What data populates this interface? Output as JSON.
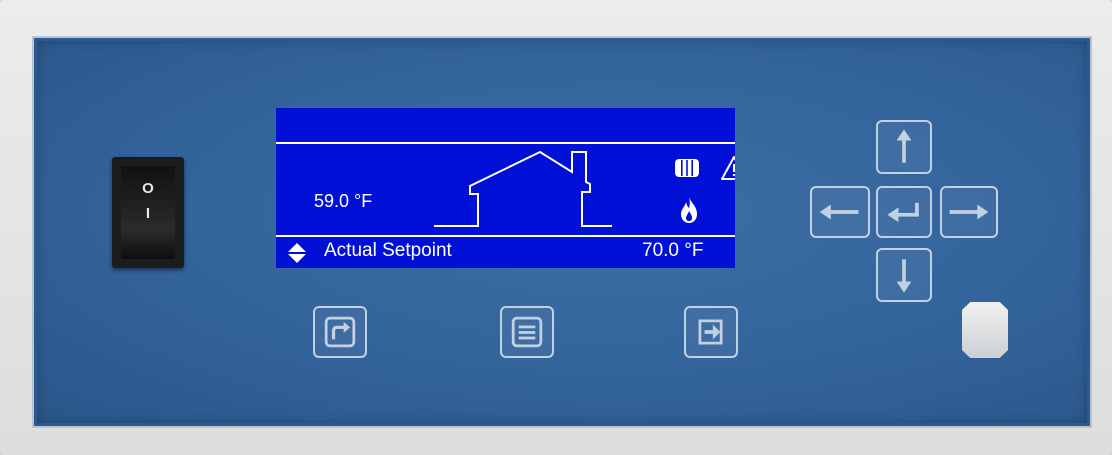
{
  "power_switch": {
    "off_mark": "O",
    "on_mark": "I"
  },
  "display": {
    "current_temperature": "59.0 °F",
    "bottom_label": "Actual Setpoint",
    "bottom_value": "70.0 °F",
    "icons": [
      "house-icon",
      "radiator-icon",
      "warning-icon",
      "flame-icon",
      "up-down-arrows-icon"
    ]
  },
  "buttons": {
    "function_keys": [
      "return-button",
      "menu-button",
      "exit-button"
    ],
    "nav_keys": [
      "up-arrow-button",
      "left-arrow-button",
      "enter-button",
      "right-arrow-button",
      "down-arrow-button"
    ]
  },
  "colors": {
    "panel": "#32629a",
    "lcd_background": "#0010d6",
    "lcd_foreground": "#ffffff",
    "key_outline": "#c2d1e2"
  }
}
